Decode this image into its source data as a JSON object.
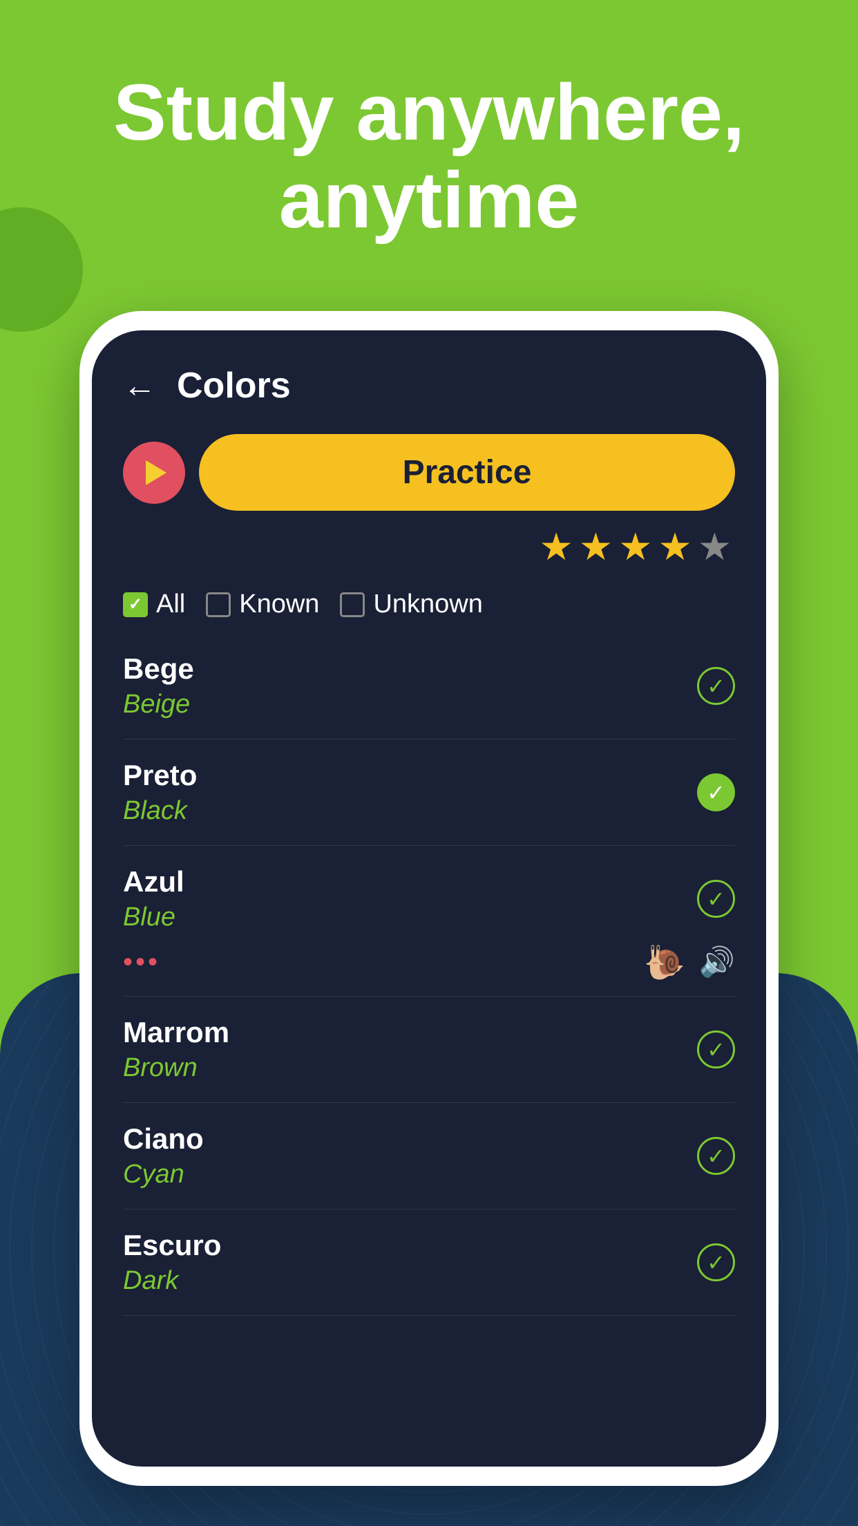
{
  "app": {
    "background_color": "#7cc832",
    "wave_color": "#1a3a5c"
  },
  "header": {
    "title": "Study anywhere, anytime"
  },
  "screen": {
    "back_label": "←",
    "screen_title": "Colors",
    "practice_button_label": "Practice",
    "stars": [
      {
        "filled": true
      },
      {
        "filled": true
      },
      {
        "filled": true
      },
      {
        "filled": true
      },
      {
        "filled": false
      }
    ],
    "filters": [
      {
        "label": "All",
        "checked": true
      },
      {
        "label": "Known",
        "checked": false
      },
      {
        "label": "Unknown",
        "checked": false
      }
    ],
    "words": [
      {
        "native": "Bege",
        "translation": "Beige",
        "known": false,
        "expanded": false
      },
      {
        "native": "Preto",
        "translation": "Black",
        "known": true,
        "expanded": false
      },
      {
        "native": "Azul",
        "translation": "Blue",
        "known": false,
        "expanded": true
      },
      {
        "native": "Marrom",
        "translation": "Brown",
        "known": false,
        "expanded": false
      },
      {
        "native": "Ciano",
        "translation": "Cyan",
        "known": false,
        "expanded": false
      },
      {
        "native": "Escuro",
        "translation": "Dark",
        "known": false,
        "expanded": false
      }
    ]
  }
}
